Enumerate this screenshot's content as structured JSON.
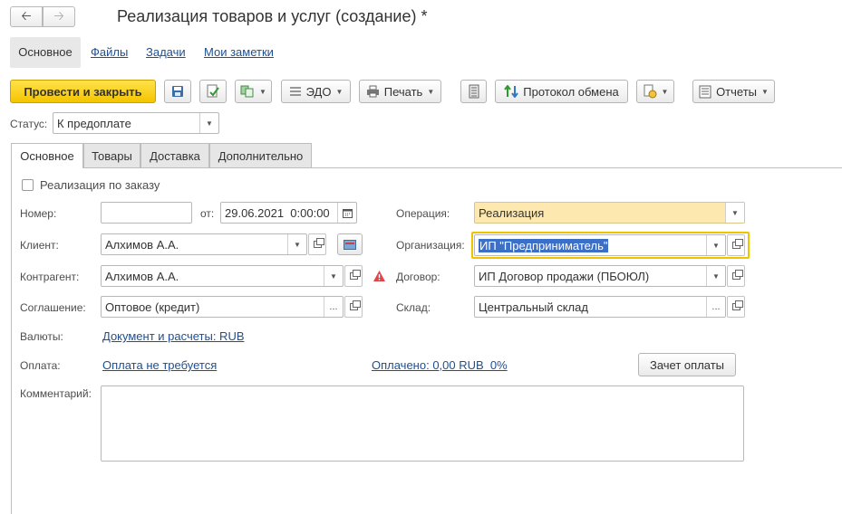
{
  "window": {
    "title": "Реализация товаров и услуг (создание) *",
    "back_icon": "arrow-left-icon",
    "forward_icon": "arrow-right-icon"
  },
  "top_nav": {
    "items": [
      "Основное",
      "Файлы",
      "Задачи",
      "Мои заметки"
    ]
  },
  "toolbar": {
    "post_close": "Провести и закрыть",
    "edo": "ЭДО",
    "print": "Печать",
    "exchange_log": "Протокол обмена",
    "reports": "Отчеты"
  },
  "status": {
    "label": "Статус:",
    "value": "К предоплате"
  },
  "tabs": [
    "Основное",
    "Товары",
    "Доставка",
    "Дополнительно"
  ],
  "form": {
    "by_order": "Реализация по заказу",
    "number_label": "Номер:",
    "number_value": "",
    "date_label": "от:",
    "date_value": "29.06.2021  0:00:00",
    "client_label": "Клиент:",
    "client_value": "Алхимов А.А.",
    "counterparty_label": "Контрагент:",
    "counterparty_value": "Алхимов А.А.",
    "agreement_label": "Соглашение:",
    "agreement_value": "Оптовое (кредит)",
    "currencies_label": "Валюты:",
    "currencies_link": "Документ и расчеты: RUB",
    "payment_label": "Оплата:",
    "payment_link": "Оплата не требуется",
    "paid_link": "Оплачено: 0,00 RUB  0%",
    "offset_button": "Зачет оплаты",
    "comment_label": "Комментарий:",
    "comment_value": "",
    "operation_label": "Операция:",
    "operation_value": "Реализация",
    "organization_label": "Организация:",
    "organization_value": "ИП \"Предприниматель\"",
    "contract_label": "Договор:",
    "contract_value": "ИП Договор продажи (ПБОЮЛ)",
    "warehouse_label": "Склад:",
    "warehouse_value": "Центральный склад"
  },
  "colors": {
    "primary_button": "#f5c400",
    "highlight_field": "#fde9b0",
    "focus_border": "#f0c300",
    "selection": "#3b6fc8",
    "link": "#1f4f8f",
    "warning": "#e0454a"
  }
}
